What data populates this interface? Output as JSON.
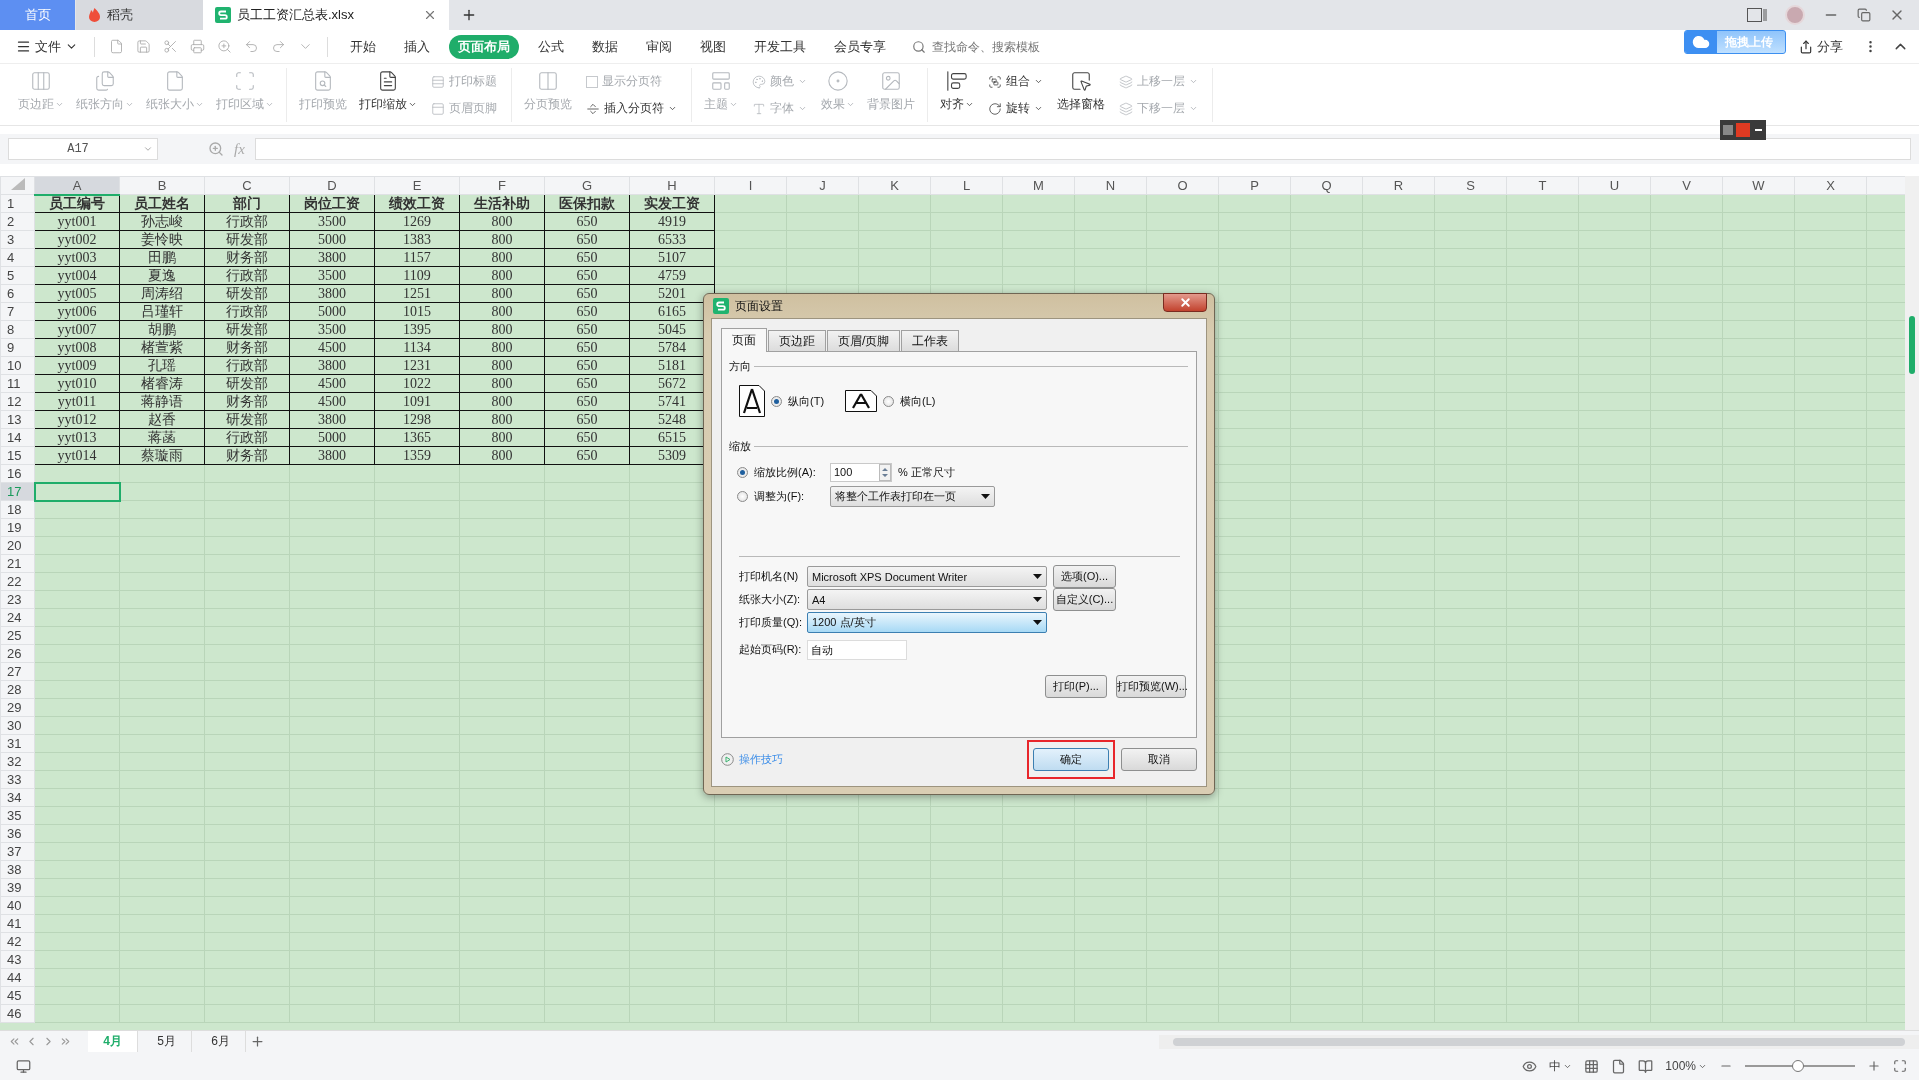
{
  "app_tabs": [
    {
      "label": "首页",
      "kind": "home",
      "selected": false
    },
    {
      "label": "稻壳",
      "kind": "docer",
      "selected": false
    },
    {
      "label": "员工工资汇总表.xlsx",
      "kind": "file",
      "selected": true
    }
  ],
  "menu": {
    "file": "文件",
    "tabs": [
      {
        "label": "开始",
        "selected": false
      },
      {
        "label": "插入",
        "selected": false
      },
      {
        "label": "页面布局",
        "selected": true
      },
      {
        "label": "公式",
        "selected": false
      },
      {
        "label": "数据",
        "selected": false
      },
      {
        "label": "审阅",
        "selected": false
      },
      {
        "label": "视图",
        "selected": false
      },
      {
        "label": "开发工具",
        "selected": false
      },
      {
        "label": "会员专享",
        "selected": false
      }
    ],
    "search": {
      "placeholder": "查找命令、搜索模板"
    },
    "cloud_upload": "拖拽上传",
    "share": "分享"
  },
  "ribbon": [
    {
      "items": [
        {
          "kind": "large",
          "label": "页边距",
          "disabled": true,
          "dropdown": true
        },
        {
          "kind": "large",
          "label": "纸张方向",
          "disabled": true,
          "dropdown": true
        },
        {
          "kind": "large",
          "label": "纸张大小",
          "disabled": true,
          "dropdown": true
        },
        {
          "kind": "large",
          "label": "打印区域",
          "disabled": true,
          "dropdown": true
        }
      ]
    },
    {
      "items": [
        {
          "kind": "large",
          "label": "打印预览",
          "disabled": true,
          "dropdown": false
        },
        {
          "kind": "large",
          "label": "打印缩放",
          "disabled": false,
          "dropdown": true
        },
        {
          "kind": "stack",
          "children": [
            {
              "kind": "small",
              "label": "打印标题",
              "disabled": true,
              "dropdown": false
            },
            {
              "kind": "small",
              "label": "页眉页脚",
              "disabled": true,
              "dropdown": false
            }
          ]
        }
      ]
    },
    {
      "items": [
        {
          "kind": "large",
          "label": "分页预览",
          "disabled": true,
          "dropdown": false
        },
        {
          "kind": "stack",
          "children": [
            {
              "kind": "check",
              "label": "显示分页符",
              "disabled": true,
              "checked": false
            },
            {
              "kind": "small",
              "label": "插入分页符",
              "disabled": false,
              "dropdown": true
            }
          ]
        }
      ]
    },
    {
      "items": [
        {
          "kind": "large",
          "label": "主题",
          "disabled": true,
          "dropdown": true
        },
        {
          "kind": "stack",
          "children": [
            {
              "kind": "small",
              "label": "颜色",
              "disabled": true,
              "dropdown": true
            },
            {
              "kind": "small",
              "label": "字体",
              "disabled": true,
              "dropdown": true
            }
          ]
        },
        {
          "kind": "large",
          "label": "效果",
          "disabled": true,
          "dropdown": true
        },
        {
          "kind": "large",
          "label": "背景图片",
          "disabled": true,
          "dropdown": false
        }
      ]
    },
    {
      "items": [
        {
          "kind": "large",
          "label": "对齐",
          "disabled": false,
          "dropdown": true
        },
        {
          "kind": "stack",
          "children": [
            {
              "kind": "small",
              "label": "组合",
              "disabled": false,
              "dropdown": true
            },
            {
              "kind": "small",
              "label": "旋转",
              "disabled": false,
              "dropdown": true
            }
          ]
        },
        {
          "kind": "large",
          "label": "选择窗格",
          "disabled": false,
          "dropdown": false
        },
        {
          "kind": "stack",
          "children": [
            {
              "kind": "small",
              "label": "上移一层",
              "disabled": true,
              "dropdown": true
            },
            {
              "kind": "small",
              "label": "下移一层",
              "disabled": true,
              "dropdown": true
            }
          ]
        }
      ]
    }
  ],
  "formula_bar": {
    "name_box": "A17",
    "fx": "fx"
  },
  "sheet": {
    "columns": [
      {
        "label": "A",
        "selected": true
      },
      {
        "label": "B",
        "selected": false
      },
      {
        "label": "C",
        "selected": false
      },
      {
        "label": "D",
        "selected": false
      },
      {
        "label": "E",
        "selected": false
      },
      {
        "label": "F",
        "selected": false
      },
      {
        "label": "G",
        "selected": false
      },
      {
        "label": "H",
        "selected": false
      },
      {
        "label": "I",
        "selected": false
      },
      {
        "label": "J",
        "selected": false
      },
      {
        "label": "K",
        "selected": false
      },
      {
        "label": "L",
        "selected": false
      },
      {
        "label": "M",
        "selected": false
      },
      {
        "label": "N",
        "selected": false
      },
      {
        "label": "O",
        "selected": false
      },
      {
        "label": "P",
        "selected": false
      },
      {
        "label": "Q",
        "selected": false
      },
      {
        "label": "R",
        "selected": false
      },
      {
        "label": "S",
        "selected": false
      },
      {
        "label": "T",
        "selected": false
      },
      {
        "label": "U",
        "selected": false
      },
      {
        "label": "V",
        "selected": false
      },
      {
        "label": "W",
        "selected": false
      },
      {
        "label": "X",
        "selected": false
      }
    ],
    "row_numbers": [
      {
        "label": "1",
        "selected": false
      },
      {
        "label": "2",
        "selected": false
      },
      {
        "label": "3",
        "selected": false
      },
      {
        "label": "4",
        "selected": false
      },
      {
        "label": "5",
        "selected": false
      },
      {
        "label": "6",
        "selected": false
      },
      {
        "label": "7",
        "selected": false
      },
      {
        "label": "8",
        "selected": false
      },
      {
        "label": "9",
        "selected": false
      },
      {
        "label": "10",
        "selected": false
      },
      {
        "label": "11",
        "selected": false
      },
      {
        "label": "12",
        "selected": false
      },
      {
        "label": "13",
        "selected": false
      },
      {
        "label": "14",
        "selected": false
      },
      {
        "label": "15",
        "selected": false
      },
      {
        "label": "16",
        "selected": false
      },
      {
        "label": "17",
        "selected": true
      },
      {
        "label": "18",
        "selected": false
      },
      {
        "label": "19",
        "selected": false
      },
      {
        "label": "20",
        "selected": false
      },
      {
        "label": "21",
        "selected": false
      },
      {
        "label": "22",
        "selected": false
      },
      {
        "label": "23",
        "selected": false
      },
      {
        "label": "24",
        "selected": false
      },
      {
        "label": "25",
        "selected": false
      },
      {
        "label": "26",
        "selected": false
      },
      {
        "label": "27",
        "selected": false
      },
      {
        "label": "28",
        "selected": false
      },
      {
        "label": "29",
        "selected": false
      },
      {
        "label": "30",
        "selected": false
      },
      {
        "label": "31",
        "selected": false
      },
      {
        "label": "32",
        "selected": false
      },
      {
        "label": "33",
        "selected": false
      },
      {
        "label": "34",
        "selected": false
      },
      {
        "label": "35",
        "selected": false
      },
      {
        "label": "36",
        "selected": false
      },
      {
        "label": "37",
        "selected": false
      },
      {
        "label": "38",
        "selected": false
      },
      {
        "label": "39",
        "selected": false
      },
      {
        "label": "40",
        "selected": false
      },
      {
        "label": "41",
        "selected": false
      },
      {
        "label": "42",
        "selected": false
      },
      {
        "label": "43",
        "selected": false
      },
      {
        "label": "44",
        "selected": false
      },
      {
        "label": "45",
        "selected": false
      },
      {
        "label": "46",
        "selected": false
      }
    ],
    "header": [
      "员工编号",
      "员工姓名",
      "部门",
      "岗位工资",
      "绩效工资",
      "生活补助",
      "医保扣款",
      "实发工资"
    ],
    "rows": [
      [
        "yyt001",
        "孙志峻",
        "行政部",
        "3500",
        "1269",
        "800",
        "650",
        "4919"
      ],
      [
        "yyt002",
        "姜怜映",
        "研发部",
        "5000",
        "1383",
        "800",
        "650",
        "6533"
      ],
      [
        "yyt003",
        "田鹏",
        "财务部",
        "3800",
        "1157",
        "800",
        "650",
        "5107"
      ],
      [
        "yyt004",
        "夏逸",
        "行政部",
        "3500",
        "1109",
        "800",
        "650",
        "4759"
      ],
      [
        "yyt005",
        "周涛绍",
        "研发部",
        "3800",
        "1251",
        "800",
        "650",
        "5201"
      ],
      [
        "yyt006",
        "吕瑾轩",
        "行政部",
        "5000",
        "1015",
        "800",
        "650",
        "6165"
      ],
      [
        "yyt007",
        "胡鹏",
        "研发部",
        "3500",
        "1395",
        "800",
        "650",
        "5045"
      ],
      [
        "yyt008",
        "楮萱紫",
        "财务部",
        "4500",
        "1134",
        "800",
        "650",
        "5784"
      ],
      [
        "yyt009",
        "孔瑶",
        "行政部",
        "3800",
        "1231",
        "800",
        "650",
        "5181"
      ],
      [
        "yyt010",
        "楮睿涛",
        "研发部",
        "4500",
        "1022",
        "800",
        "650",
        "5672"
      ],
      [
        "yyt011",
        "蒋静语",
        "财务部",
        "4500",
        "1091",
        "800",
        "650",
        "5741"
      ],
      [
        "yyt012",
        "赵香",
        "研发部",
        "3800",
        "1298",
        "800",
        "650",
        "5248"
      ],
      [
        "yyt013",
        "蒋菡",
        "行政部",
        "5000",
        "1365",
        "800",
        "650",
        "6515"
      ],
      [
        "yyt014",
        "蔡璇雨",
        "财务部",
        "3800",
        "1359",
        "800",
        "650",
        "5309"
      ]
    ]
  },
  "sheet_tabs": [
    {
      "label": "4月",
      "selected": true
    },
    {
      "label": "5月",
      "selected": false
    },
    {
      "label": "6月",
      "selected": false
    }
  ],
  "status": {
    "input_mode": "中",
    "zoom": "100%",
    "zoom_slider": {
      "level": 0.48
    }
  },
  "dialog": {
    "title": "页面设置",
    "tabs": [
      {
        "label": "页面",
        "selected": true
      },
      {
        "label": "页边距",
        "selected": false
      },
      {
        "label": "页眉/页脚",
        "selected": false
      },
      {
        "label": "工作表",
        "selected": false
      }
    ],
    "orientation": {
      "legend": "方向",
      "options": [
        {
          "label": "纵向(T)",
          "kind": "portrait",
          "selected": true
        },
        {
          "label": "横向(L)",
          "kind": "landscape",
          "selected": false
        }
      ]
    },
    "scaling": {
      "legend": "缩放",
      "options": [
        {
          "label": "缩放比例(A):",
          "kind": "percent",
          "selected": true,
          "value": "100",
          "suffix": "% 正常尺寸"
        },
        {
          "label": "调整为(F):",
          "kind": "fit",
          "selected": false,
          "value": "将整个工作表打印在一页"
        }
      ]
    },
    "fields": [
      {
        "label": "打印机名(N)",
        "kind": "select",
        "value": "Microsoft XPS Document Writer",
        "button": "选项(O)...",
        "focused": false
      },
      {
        "label": "纸张大小(Z):",
        "kind": "select",
        "value": "A4",
        "button": "自定义(C)...",
        "focused": false
      },
      {
        "label": "打印质量(Q):",
        "kind": "select",
        "value": "1200 点/英寸",
        "focused": true
      },
      {
        "label": "起始页码(R):",
        "kind": "input",
        "value": "自动",
        "focused": false
      }
    ],
    "print_buttons": [
      "打印(P)...",
      "打印预览(W)..."
    ],
    "tips_link": "操作技巧",
    "ok": {
      "label": "确定",
      "highlighted": true
    },
    "cancel": "取消"
  }
}
